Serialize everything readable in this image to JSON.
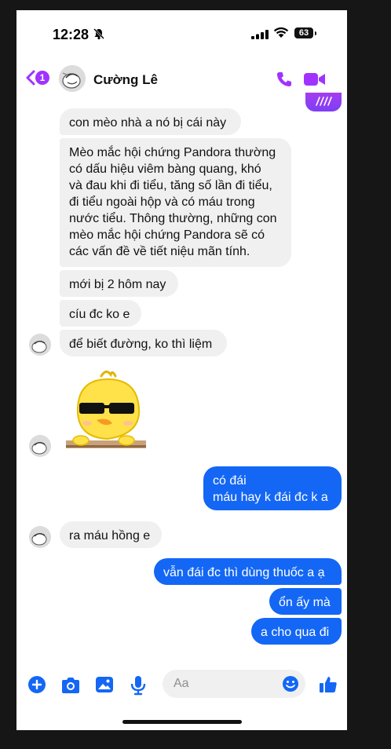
{
  "status_bar": {
    "time": "12:28",
    "battery": "63"
  },
  "header": {
    "back_badge": "1",
    "contact_name": "Cường Lê"
  },
  "messages": [
    {
      "side": "in",
      "text": "con mèo nhà a nó bị cái này"
    },
    {
      "side": "in",
      "text": "Mèo mắc hội chứng Pandora thường\ncó dấu hiệu viêm bàng quang, khó\nvà đau khi đi tiểu, tăng số lần đi tiểu,\nđi tiểu ngoài hộp và có máu trong\nnước tiểu. Thông thường, những con\nmèo mắc hội chứng Pandora sẽ có\ncác vấn đề về tiết niệu mãn tính."
    },
    {
      "side": "in",
      "text": "mới bị 2 hôm nay"
    },
    {
      "side": "in",
      "text": "cíu đc ko e"
    },
    {
      "side": "in",
      "text": "để biết đường, ko thì liệm"
    },
    {
      "side": "out",
      "text": "có đái\nmáu hay k đái đc k a"
    },
    {
      "side": "in",
      "text": "ra máu hồng e"
    },
    {
      "side": "out",
      "text": "vẫn đái đc thì dùng thuốc a ạ"
    },
    {
      "side": "out",
      "text": "ổn ấy mà"
    },
    {
      "side": "out",
      "text": "a cho qua đi"
    }
  ],
  "composer": {
    "placeholder": "Aa"
  },
  "colors": {
    "accent_purple": "#a033ff",
    "outgoing_bubble": "#1467f5",
    "incoming_bubble": "#f0f0f0"
  }
}
